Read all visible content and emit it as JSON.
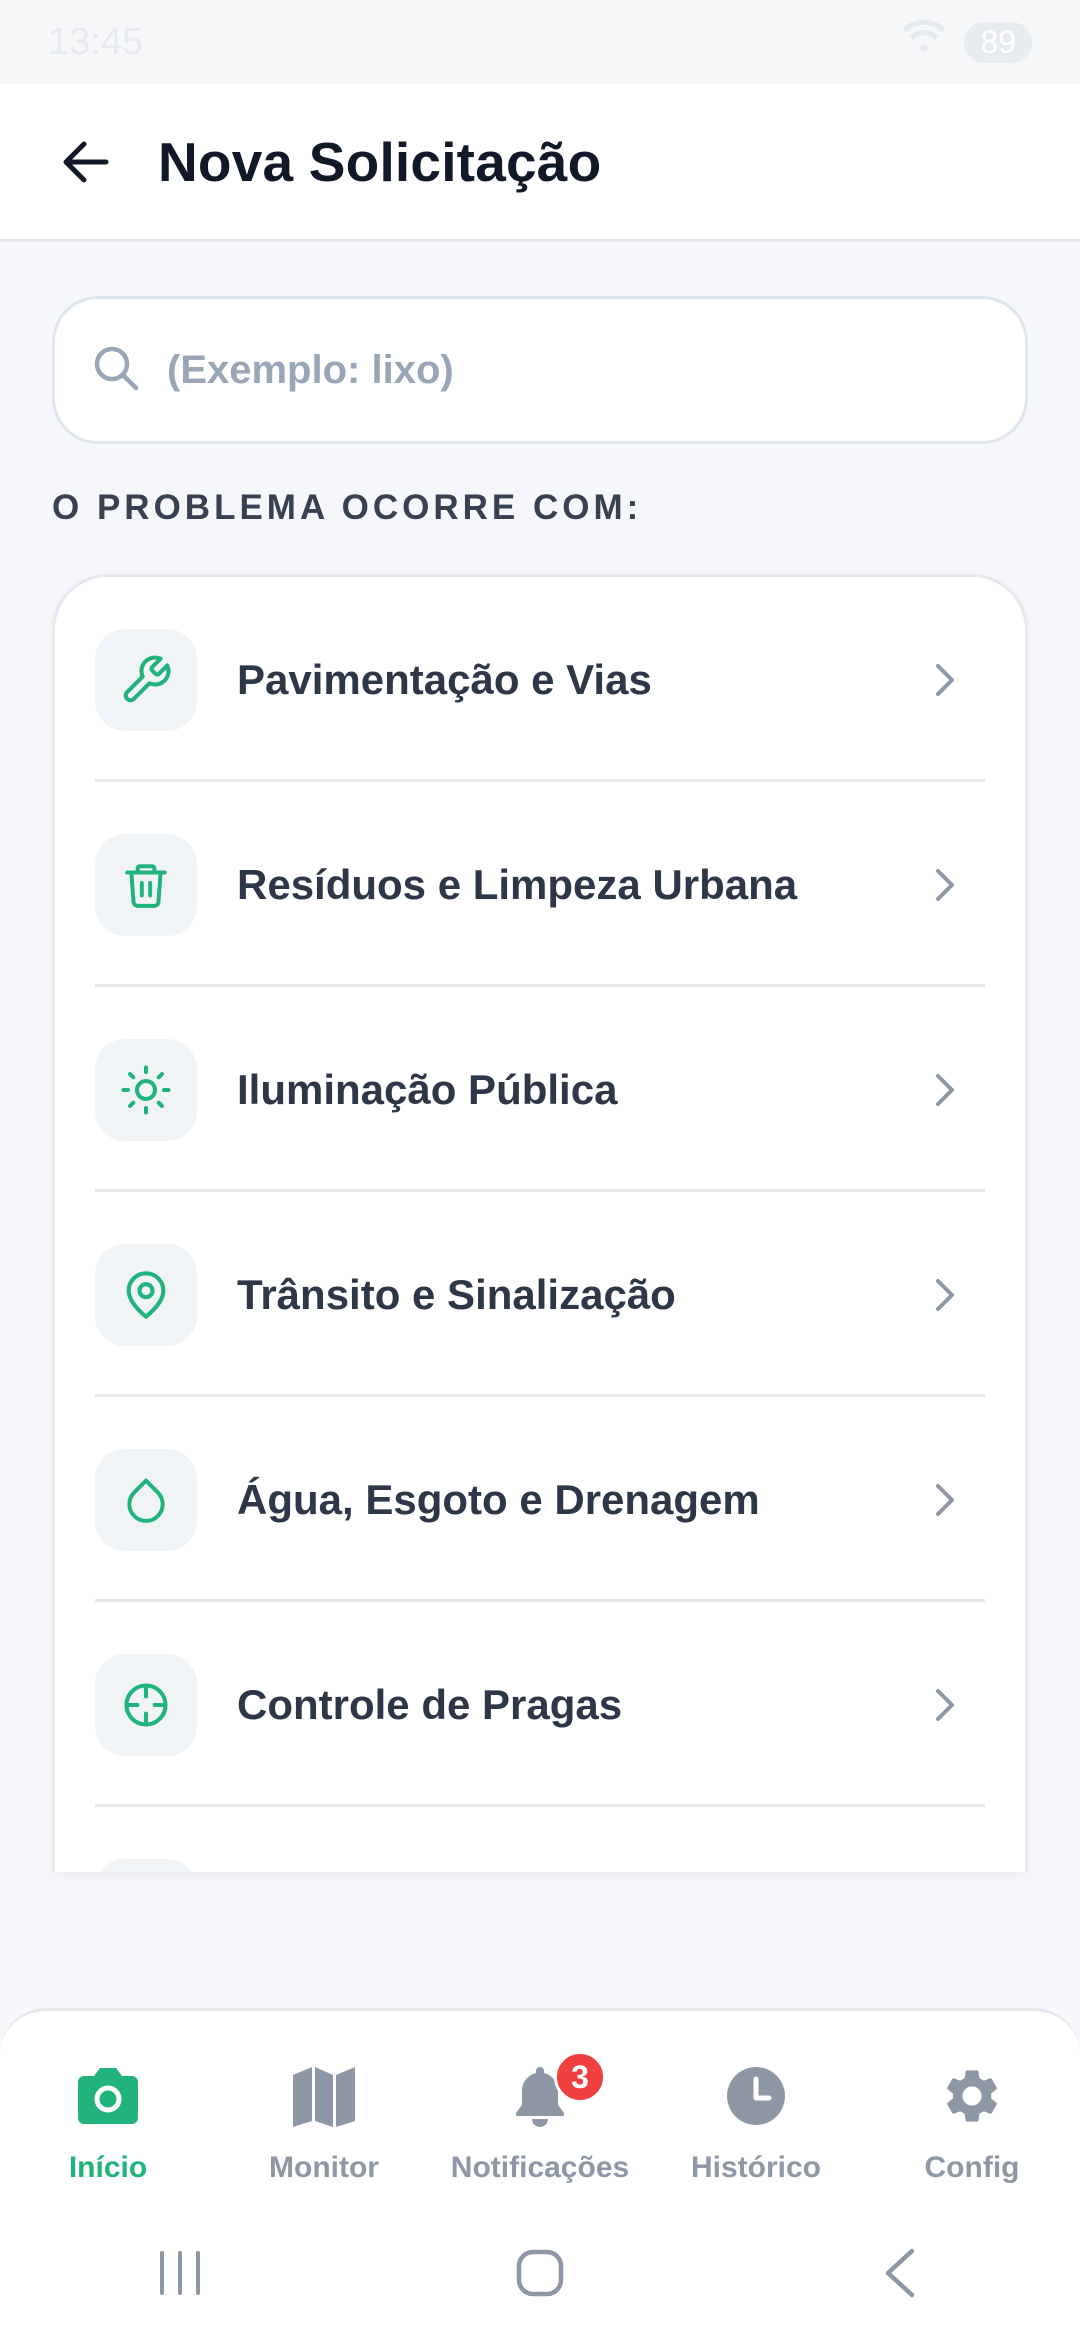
{
  "status_bar": {
    "time": "13:45",
    "battery": "89"
  },
  "header": {
    "title": "Nova Solicitação"
  },
  "search": {
    "placeholder": "(Exemplo: lixo)"
  },
  "section": {
    "label": "O PROBLEMA OCORRE COM:"
  },
  "categories": [
    {
      "label": "Pavimentação e Vias",
      "icon": "wrench-icon"
    },
    {
      "label": "Resíduos e Limpeza Urbana",
      "icon": "trash-icon"
    },
    {
      "label": "Iluminação Pública",
      "icon": "sun-icon"
    },
    {
      "label": "Trânsito e Sinalização",
      "icon": "map-pin-icon"
    },
    {
      "label": "Água, Esgoto e Drenagem",
      "icon": "droplet-icon"
    },
    {
      "label": "Controle de Pragas",
      "icon": "crosshair-icon"
    }
  ],
  "bottom_nav": [
    {
      "label": "Início",
      "icon": "camera-icon",
      "active": true
    },
    {
      "label": "Monitor",
      "icon": "map-icon"
    },
    {
      "label": "Notificações",
      "icon": "bell-icon",
      "badge": "3"
    },
    {
      "label": "Histórico",
      "icon": "clock-icon"
    },
    {
      "label": "Config",
      "icon": "gear-icon"
    }
  ],
  "colors": {
    "accent": "#20b37c",
    "badge": "#ef3f3f",
    "text_primary": "#111827",
    "muted": "#8d97a5"
  }
}
